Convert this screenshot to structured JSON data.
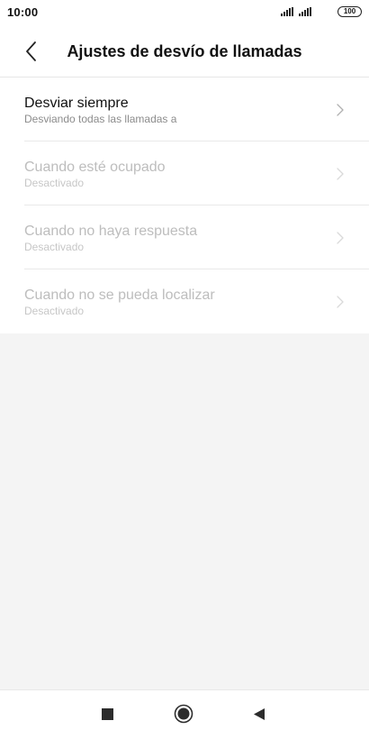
{
  "status_bar": {
    "time": "10:00",
    "battery": "100"
  },
  "header": {
    "title": "Ajustes de desvío de llamadas"
  },
  "list": {
    "items": [
      {
        "title": "Desviar siempre",
        "subtitle": "Desviando todas las llamadas a",
        "enabled": true
      },
      {
        "title": "Cuando esté ocupado",
        "subtitle": "Desactivado",
        "enabled": false
      },
      {
        "title": "Cuando no haya respuesta",
        "subtitle": "Desactivado",
        "enabled": false
      },
      {
        "title": "Cuando no se pueda localizar",
        "subtitle": "Desactivado",
        "enabled": false
      }
    ]
  },
  "icons": {
    "back": "chevron-left-icon",
    "row": "chevron-right-icon",
    "nav_recent": "square-icon",
    "nav_home": "circle-icon",
    "nav_back": "triangle-back-icon"
  },
  "colors": {
    "background": "#f4f4f4",
    "surface": "#ffffff",
    "text_primary": "#111111",
    "text_secondary": "#8c8c8c",
    "text_disabled": "#bdbdbd"
  }
}
